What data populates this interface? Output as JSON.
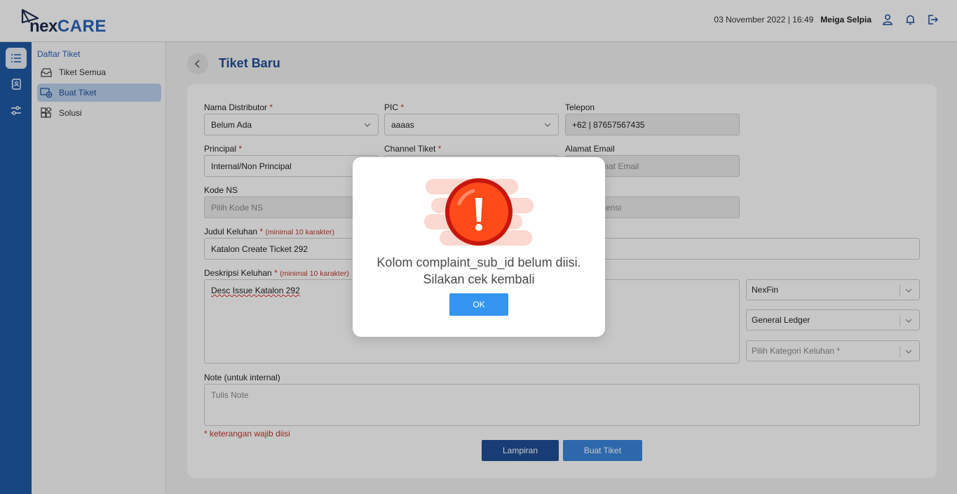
{
  "header": {
    "logo_nex": "nex",
    "logo_care": "CARE",
    "datetime": "03 November 2022 | 16:49",
    "user": "Meiga Selpia"
  },
  "rail": {
    "icons": [
      "list-icon",
      "address-book-icon",
      "sliders-icon"
    ]
  },
  "sidebar": {
    "title": "Daftar Tiket",
    "items": [
      {
        "label": "Tiket Semua",
        "icon": "ticket-box-icon"
      },
      {
        "label": "Buat Tiket",
        "icon": "ticket-add-icon"
      },
      {
        "label": "Solusi",
        "icon": "solution-icon"
      }
    ]
  },
  "page": {
    "title": "Tiket Baru"
  },
  "form": {
    "nama_distributor": {
      "label": "Nama Distributor",
      "req": "*",
      "value": "Belum Ada"
    },
    "pic": {
      "label": "PIC",
      "req": "*",
      "value": "aaaas"
    },
    "telepon": {
      "label": "Telepon",
      "value": "+62 | 87657567435"
    },
    "principal": {
      "label": "Principal",
      "req": "*",
      "value": "Internal/Non Principal"
    },
    "channel_tiket": {
      "label": "Channel Tiket",
      "req": "*"
    },
    "alamat_email": {
      "label": "Alamat Email",
      "placeholder": "mat Email"
    },
    "kode_ns": {
      "label": "Kode NS",
      "placeholder": "Pilih Kode NS"
    },
    "lisensi": {
      "placeholder": "sensi"
    },
    "judul": {
      "label": "Judul Keluhan",
      "req": "*",
      "hint": "(minimal 10 karakter)",
      "value": "Katalon Create Ticket 292"
    },
    "deskripsi": {
      "label": "Deskripsi Keluhan",
      "req": "*",
      "hint": "(minimal 10 karakter)",
      "value": "Desc Issue Katalon 292"
    },
    "produk": {
      "value": "NexFin"
    },
    "modul": {
      "value": "General Ledger"
    },
    "kategori": {
      "placeholder": "Pilih Kategori Keluhan *"
    },
    "note": {
      "label": "Note (untuk internal)",
      "placeholder": "Tulis Note"
    },
    "wajib": "* keterangan wajib diisi",
    "btn_lampiran": "Lampiran",
    "btn_buat": "Buat Tiket"
  },
  "modal": {
    "icon": "exclamation-warning-icon",
    "line1": "Kolom complaint_sub_id belum diisi.",
    "line2": "Silakan cek kembali",
    "ok": "OK"
  },
  "colors": {
    "primary": "#1f5aa6",
    "accent": "#3a86dd",
    "warning": "#ff4a1a",
    "required": "#c0392b"
  }
}
